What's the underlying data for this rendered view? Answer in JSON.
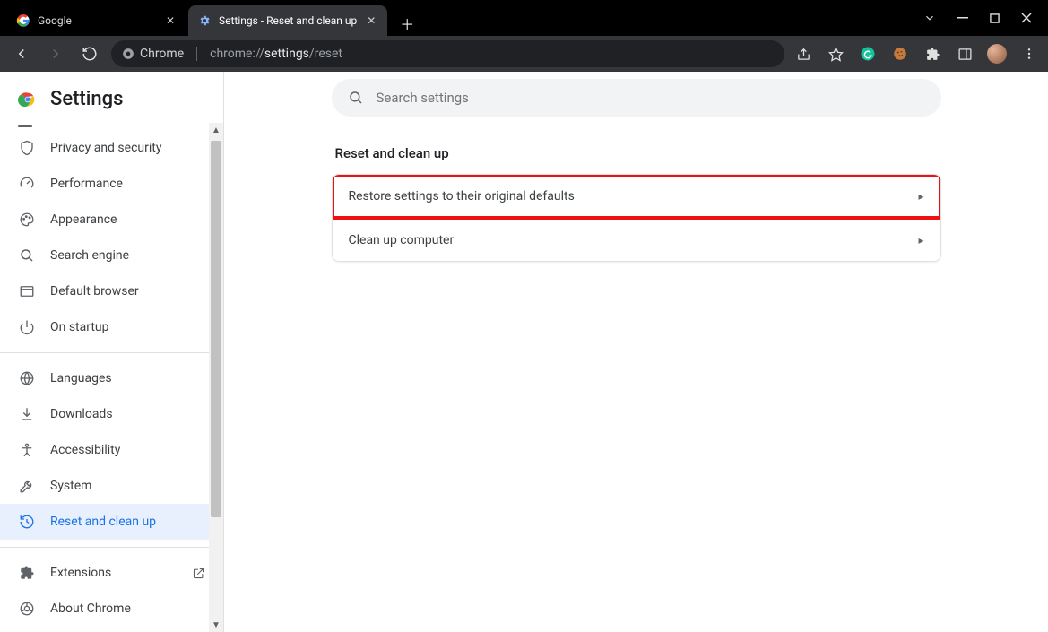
{
  "browser_tabs": [
    {
      "title": "Google",
      "active": false
    },
    {
      "title": "Settings - Reset and clean up",
      "active": true
    }
  ],
  "addressbar": {
    "chip_label": "Chrome",
    "url_prefix": "chrome://",
    "url_bold": "settings",
    "url_suffix": "/reset"
  },
  "page_title": "Settings",
  "search": {
    "placeholder": "Search settings"
  },
  "sidebar": {
    "items_top": [
      {
        "id": "privacy",
        "label": "Privacy and security"
      },
      {
        "id": "performance",
        "label": "Performance"
      },
      {
        "id": "appearance",
        "label": "Appearance"
      },
      {
        "id": "search",
        "label": "Search engine"
      },
      {
        "id": "defaultb",
        "label": "Default browser"
      },
      {
        "id": "startup",
        "label": "On startup"
      }
    ],
    "items_mid": [
      {
        "id": "languages",
        "label": "Languages"
      },
      {
        "id": "downloads",
        "label": "Downloads"
      },
      {
        "id": "accessibility",
        "label": "Accessibility"
      },
      {
        "id": "system",
        "label": "System"
      },
      {
        "id": "reset",
        "label": "Reset and clean up",
        "active": true
      }
    ],
    "items_bot": [
      {
        "id": "extensions",
        "label": "Extensions",
        "external": true
      },
      {
        "id": "about",
        "label": "About Chrome"
      }
    ]
  },
  "section": {
    "title": "Reset and clean up",
    "rows": [
      {
        "label": "Restore settings to their original defaults",
        "highlight": true
      },
      {
        "label": "Clean up computer",
        "highlight": false
      }
    ]
  }
}
